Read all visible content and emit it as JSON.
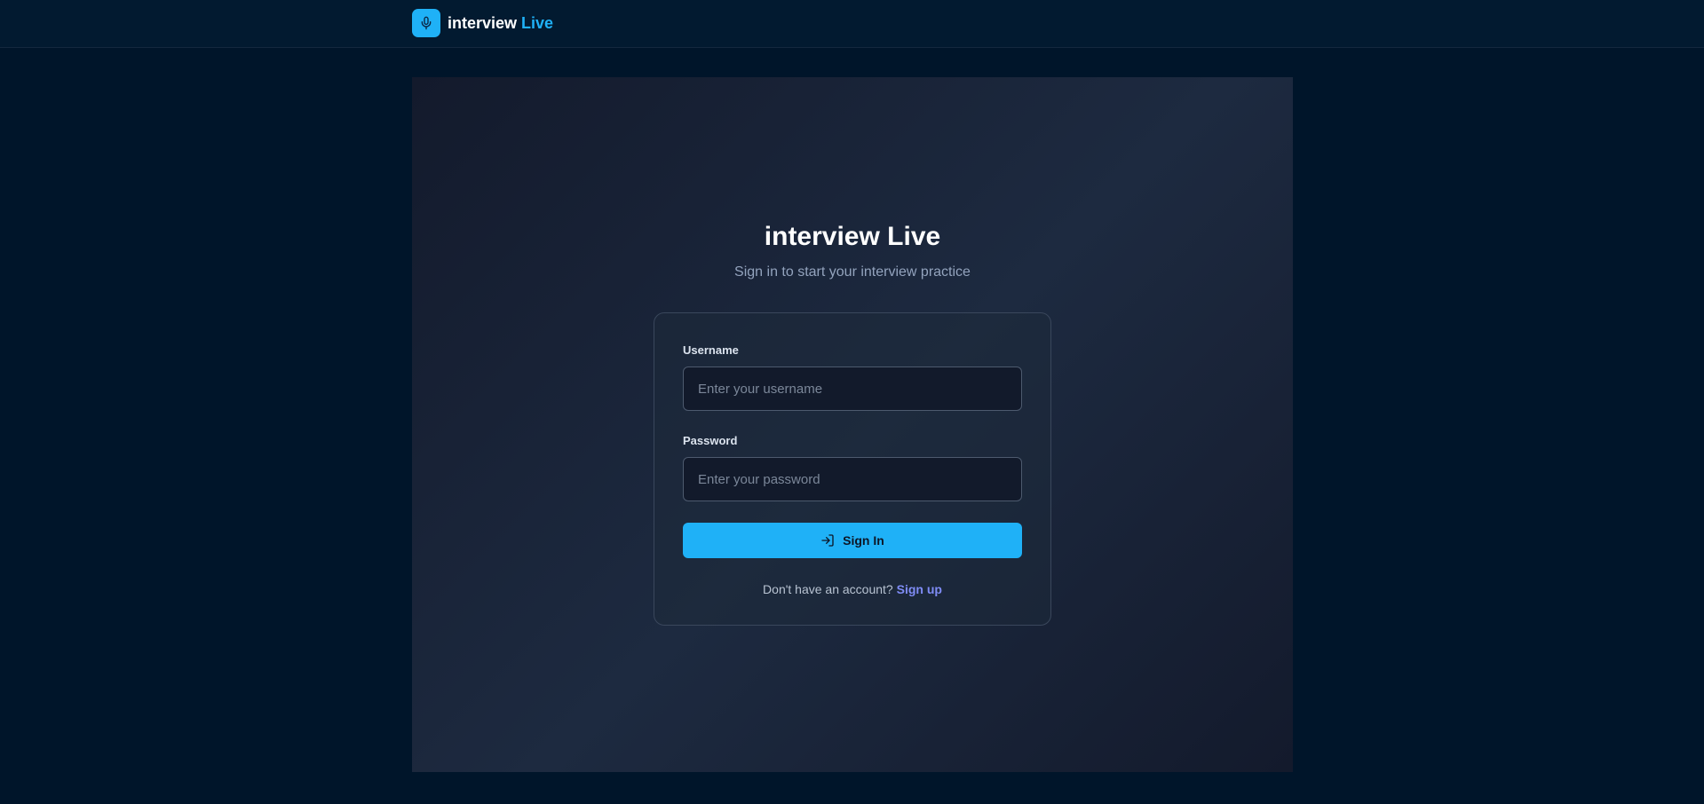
{
  "header": {
    "brand_name": "interview",
    "brand_accent": "Live",
    "logo_icon": "microphone-icon"
  },
  "hero": {
    "title": "interview Live",
    "subtitle": "Sign in to start your interview practice"
  },
  "form": {
    "username_label": "Username",
    "username_placeholder": "Enter your username",
    "username_value": "",
    "password_label": "Password",
    "password_placeholder": "Enter your password",
    "password_value": "",
    "signin_icon": "sign-in-icon",
    "signin_label": "Sign In",
    "signup_prompt": "Don't have an account?",
    "signup_link": "Sign up"
  },
  "colors": {
    "accent": "#1fb1f7",
    "background": "#00152a",
    "link": "#7f8cf5"
  }
}
